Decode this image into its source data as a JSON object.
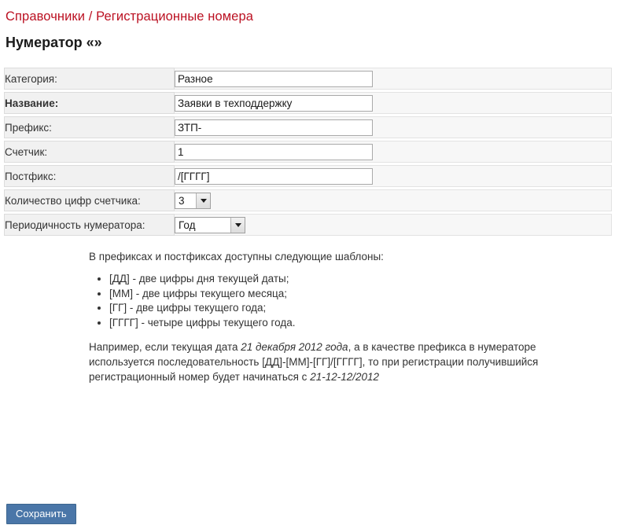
{
  "breadcrumb": {
    "full": "Справочники / Регистрационные номера",
    "section": "Справочники",
    "separator": "/",
    "page": "Регистрационные номера",
    "color": "#bb1122"
  },
  "page_title": "Нумератор «»",
  "form": {
    "rows": [
      {
        "label": "Категория:",
        "bold": false,
        "control": "text",
        "value": "Разное",
        "placeholder": ""
      },
      {
        "label": "Название:",
        "bold": true,
        "control": "text",
        "value": "Заявки в техподдержку",
        "placeholder": ""
      },
      {
        "label": "Префикс:",
        "bold": false,
        "control": "text",
        "value": "ЗТП-",
        "placeholder": ""
      },
      {
        "label": "Счетчик:",
        "bold": false,
        "control": "text",
        "value": "1",
        "placeholder": ""
      },
      {
        "label": "Постфикс:",
        "bold": false,
        "control": "text",
        "value": "/[ГГГГ]",
        "placeholder": ""
      },
      {
        "label": "Количество цифр счетчика:",
        "bold": false,
        "control": "select-digits",
        "value": "3"
      },
      {
        "label": "Периодичность нумератора:",
        "bold": false,
        "control": "select-period",
        "value": "Год"
      }
    ]
  },
  "help": {
    "intro": "В префиксах и постфиксах доступны следующие шаблоны:",
    "templates": [
      "[ДД] - две цифры дня текущей даты;",
      "[ММ] - две цифры текущего месяца;",
      "[ГГ] - две цифры текущего года;",
      "[ГГГГ] - четыре цифры текущего года."
    ],
    "example": {
      "part1": "Например, если текущая дата ",
      "date_italic": "21 декабря 2012 года",
      "part2": ", а в качестве префикса в нумераторе используется последовательность [ДД]-[ММ]-[ГГ]/[ГГГГ], то при регистрации получившийся регистрационный номер будет начинаться с ",
      "result_italic": "21-12-12/2012"
    }
  },
  "actions": {
    "save_label": "Сохранить",
    "save_color": "#4a76a8"
  }
}
